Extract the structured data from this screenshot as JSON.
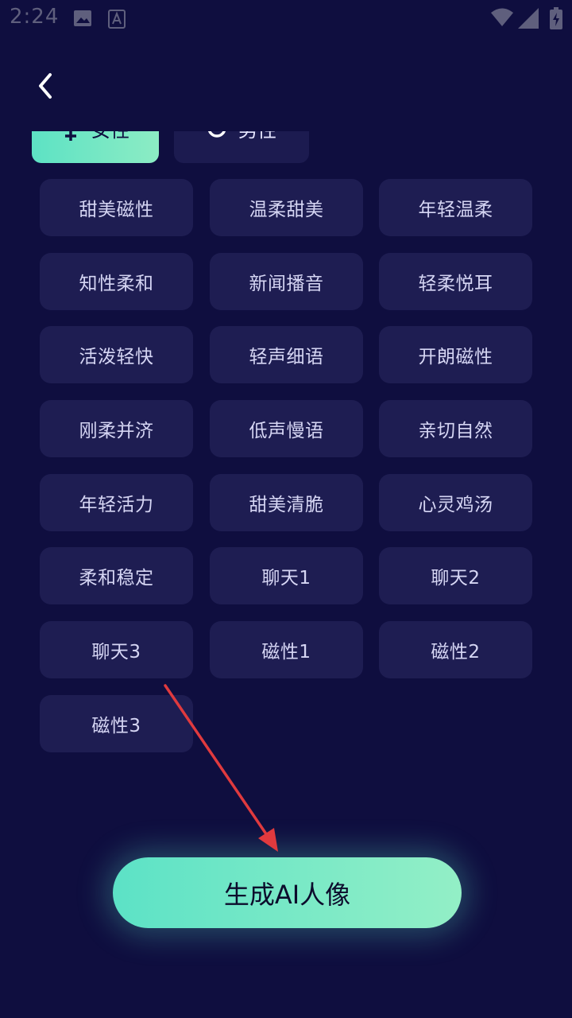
{
  "status_bar": {
    "time": "2:24",
    "icons": [
      "image-notification-icon",
      "a-notification-icon",
      "wifi-icon",
      "signal-icon",
      "battery-icon"
    ]
  },
  "nav": {
    "back_icon": "chevron-left-icon"
  },
  "gender_tabs": [
    {
      "label": "女性",
      "icon": "female-symbol-icon",
      "selected": true
    },
    {
      "label": "男性",
      "icon": "radio-circle-icon",
      "selected": false
    }
  ],
  "voices": [
    "甜美磁性",
    "温柔甜美",
    "年轻温柔",
    "知性柔和",
    "新闻播音",
    "轻柔悦耳",
    "活泼轻快",
    "轻声细语",
    "开朗磁性",
    "刚柔并济",
    "低声慢语",
    "亲切自然",
    "年轻活力",
    "甜美清脆",
    "心灵鸡汤",
    "柔和稳定",
    "聊天1",
    "聊天2",
    "聊天3",
    "磁性1",
    "磁性2",
    "磁性3"
  ],
  "annotation": {
    "type": "red-arrow",
    "color": "#e03a3e"
  },
  "generate_button": {
    "label": "生成AI人像"
  },
  "colors": {
    "background": "#0f0e3f",
    "card": "#1e1d52",
    "accent_start": "#5ce2c6",
    "accent_end": "#93efc6"
  }
}
